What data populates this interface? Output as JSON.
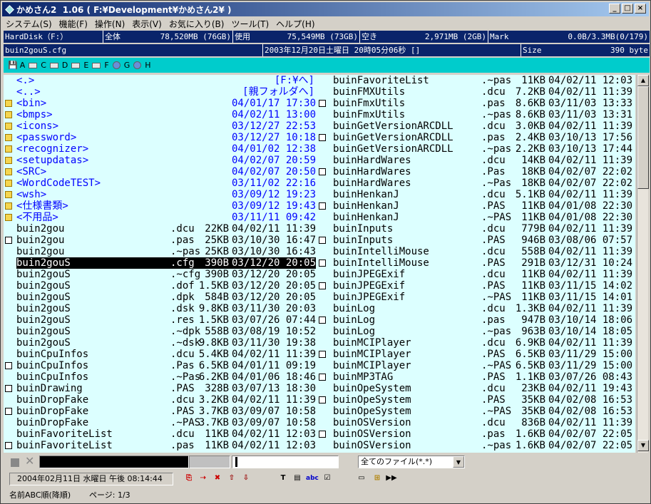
{
  "title": "かめさん2  1.06 ( F:¥Development¥かめさん2¥ )",
  "menu": [
    "システム(S)",
    "機能(F)",
    "操作(N)",
    "表示(V)",
    "お気に入り(B)",
    "ツール(T)",
    "ヘルプ(H)"
  ],
  "info1": {
    "drive": "HardDisk（F:）",
    "total_label": "全体",
    "total_value": "78,520MB (76GB)",
    "used_label": "使用",
    "used_value": "75,549MB (73GB)",
    "free_label": "空き",
    "free_value": "2,971MB (2GB)",
    "mark_label": "Mark",
    "mark_value": "0.0B/3.3MB(0/179)"
  },
  "info2": {
    "file": "buin2gouS.cfg",
    "date": "2003年12月20日土曜日 20時05分06秒 []",
    "size_label": "Size",
    "size_value": "390 byte"
  },
  "drives": [
    "A",
    "C",
    "D",
    "E",
    "F",
    "G",
    "H"
  ],
  "left_rows": [
    {
      "type": "up",
      "nm": "<.>",
      "ex": "",
      "sz": "",
      "dt": "[F:¥へ]"
    },
    {
      "type": "up",
      "nm": "<..>",
      "ex": "",
      "sz": "",
      "dt": "[親フォルダへ]"
    },
    {
      "type": "dir",
      "nm": "<bin>",
      "ex": "",
      "sz": "",
      "dt": "04/01/17 17:30"
    },
    {
      "type": "dir",
      "nm": "<bmps>",
      "ex": "",
      "sz": "",
      "dt": "04/02/11 13:00"
    },
    {
      "type": "dir",
      "nm": "<icons>",
      "ex": "",
      "sz": "",
      "dt": "03/12/27 22:53"
    },
    {
      "type": "dir",
      "nm": "<password>",
      "ex": "",
      "sz": "",
      "dt": "03/12/27 10:18"
    },
    {
      "type": "dir",
      "nm": "<recognizer>",
      "ex": "",
      "sz": "",
      "dt": "04/01/02 12:38"
    },
    {
      "type": "dir",
      "nm": "<setupdatas>",
      "ex": "",
      "sz": "",
      "dt": "04/02/07 20:59"
    },
    {
      "type": "dir",
      "nm": "<SRC>",
      "ex": "",
      "sz": "",
      "dt": "04/02/07 20:50"
    },
    {
      "type": "dir",
      "nm": "<WordCodeTEST>",
      "ex": "",
      "sz": "",
      "dt": "03/11/02 22:16"
    },
    {
      "type": "dir",
      "nm": "<wsh>",
      "ex": "",
      "sz": "",
      "dt": "03/09/12 19:23"
    },
    {
      "type": "dir",
      "nm": "<仕様書類>",
      "ex": "",
      "sz": "",
      "dt": "03/09/12 19:43"
    },
    {
      "type": "dir",
      "nm": "<不用品>",
      "ex": "",
      "sz": "",
      "dt": "03/11/11 09:42"
    },
    {
      "type": "file",
      "nm": "buin2gou",
      "ex": ".dcu",
      "sz": "22KB",
      "dt": "04/02/11 11:39"
    },
    {
      "type": "doc",
      "nm": "buin2gou",
      "ex": ".pas",
      "sz": "25KB",
      "dt": "03/10/30 16:47"
    },
    {
      "type": "file",
      "nm": "buin2gou",
      "ex": ".~pas",
      "sz": "25KB",
      "dt": "03/10/30 16:43"
    },
    {
      "type": "sel",
      "nm": "buin2gouS",
      "ex": ".cfg",
      "sz": "390B",
      "dt": "03/12/20 20:05"
    },
    {
      "type": "file",
      "nm": "buin2gouS",
      "ex": ".~cfg",
      "sz": "390B",
      "dt": "03/12/20 20:05"
    },
    {
      "type": "file",
      "nm": "buin2gouS",
      "ex": ".dof",
      "sz": "1.5KB",
      "dt": "03/12/20 20:05"
    },
    {
      "type": "file",
      "nm": "buin2gouS",
      "ex": ".dpk",
      "sz": "584B",
      "dt": "03/12/20 20:05"
    },
    {
      "type": "file",
      "nm": "buin2gouS",
      "ex": ".dsk",
      "sz": "9.8KB",
      "dt": "03/11/30 20:03"
    },
    {
      "type": "file",
      "nm": "buin2gouS",
      "ex": ".res",
      "sz": "1.5KB",
      "dt": "03/07/26 07:44"
    },
    {
      "type": "file",
      "nm": "buin2gouS",
      "ex": ".~dpk",
      "sz": "558B",
      "dt": "03/08/19 10:52"
    },
    {
      "type": "file",
      "nm": "buin2gouS",
      "ex": ".~dsk",
      "sz": "9.8KB",
      "dt": "03/11/30 19:38"
    },
    {
      "type": "file",
      "nm": "buinCpuInfos",
      "ex": ".dcu",
      "sz": "5.4KB",
      "dt": "04/02/11 11:39"
    },
    {
      "type": "doc",
      "nm": "buinCpuInfos",
      "ex": ".Pas",
      "sz": "6.5KB",
      "dt": "04/01/11 09:19"
    },
    {
      "type": "file",
      "nm": "buinCpuInfos",
      "ex": ".~Pas",
      "sz": "6.2KB",
      "dt": "04/01/06 18:46"
    },
    {
      "type": "doc",
      "nm": "buinDrawing",
      "ex": ".PAS",
      "sz": "328B",
      "dt": "03/07/13 18:30"
    },
    {
      "type": "file",
      "nm": "buinDropFake",
      "ex": ".dcu",
      "sz": "3.2KB",
      "dt": "04/02/11 11:39"
    },
    {
      "type": "doc",
      "nm": "buinDropFake",
      "ex": ".PAS",
      "sz": "3.7KB",
      "dt": "03/09/07 10:58"
    },
    {
      "type": "file",
      "nm": "buinDropFake",
      "ex": ".~PAS",
      "sz": "3.7KB",
      "dt": "03/09/07 10:58"
    },
    {
      "type": "file",
      "nm": "buinFavoriteList",
      "ex": ".dcu",
      "sz": "11KB",
      "dt": "04/02/11 12:03"
    },
    {
      "type": "doc",
      "nm": "buinFavoriteList",
      "ex": ".pas",
      "sz": "11KB",
      "dt": "04/02/11 12:03"
    }
  ],
  "right_rows": [
    {
      "type": "file",
      "nm": "buinFavoriteList",
      "ex": ".~pas",
      "sz": "11KB",
      "dt": "04/02/11 12:03"
    },
    {
      "type": "file",
      "nm": "buinFMXUtils",
      "ex": ".dcu",
      "sz": "7.2KB",
      "dt": "04/02/11 11:39"
    },
    {
      "type": "doc",
      "nm": "buinFmxUtils",
      "ex": ".pas",
      "sz": "8.6KB",
      "dt": "03/11/03 13:33"
    },
    {
      "type": "file",
      "nm": "buinFmxUtils",
      "ex": ".~pas",
      "sz": "8.6KB",
      "dt": "03/11/03 13:31"
    },
    {
      "type": "file",
      "nm": "buinGetVersionARCDLL",
      "ex": ".dcu",
      "sz": "3.0KB",
      "dt": "04/02/11 11:39"
    },
    {
      "type": "doc",
      "nm": "buinGetVersionARCDLL",
      "ex": ".pas",
      "sz": "2.4KB",
      "dt": "03/10/13 17:56"
    },
    {
      "type": "file",
      "nm": "buinGetVersionARCDLL",
      "ex": ".~pas",
      "sz": "2.2KB",
      "dt": "03/10/13 17:44"
    },
    {
      "type": "file",
      "nm": "buinHardWares",
      "ex": ".dcu",
      "sz": "14KB",
      "dt": "04/02/11 11:39"
    },
    {
      "type": "doc",
      "nm": "buinHardWares",
      "ex": ".Pas",
      "sz": "18KB",
      "dt": "04/02/07 22:02"
    },
    {
      "type": "file",
      "nm": "buinHardWares",
      "ex": ".~Pas",
      "sz": "18KB",
      "dt": "04/02/07 22:02"
    },
    {
      "type": "file",
      "nm": "buinHenkanJ",
      "ex": ".dcu",
      "sz": "5.1KB",
      "dt": "04/02/11 11:39"
    },
    {
      "type": "doc",
      "nm": "buinHenkanJ",
      "ex": ".PAS",
      "sz": "11KB",
      "dt": "04/01/08 22:30"
    },
    {
      "type": "file",
      "nm": "buinHenkanJ",
      "ex": ".~PAS",
      "sz": "11KB",
      "dt": "04/01/08 22:30"
    },
    {
      "type": "file",
      "nm": "buinInputs",
      "ex": ".dcu",
      "sz": "779B",
      "dt": "04/02/11 11:39"
    },
    {
      "type": "doc",
      "nm": "buinInputs",
      "ex": ".PAS",
      "sz": "946B",
      "dt": "03/08/06 07:57"
    },
    {
      "type": "file",
      "nm": "buinIntelliMouse",
      "ex": ".dcu",
      "sz": "558B",
      "dt": "04/02/11 11:39"
    },
    {
      "type": "doc",
      "nm": "buinIntelliMouse",
      "ex": ".PAS",
      "sz": "291B",
      "dt": "03/12/31 10:24"
    },
    {
      "type": "file",
      "nm": "buinJPEGExif",
      "ex": ".dcu",
      "sz": "11KB",
      "dt": "04/02/11 11:39"
    },
    {
      "type": "doc",
      "nm": "buinJPEGExif",
      "ex": ".PAS",
      "sz": "11KB",
      "dt": "03/11/15 14:02"
    },
    {
      "type": "file",
      "nm": "buinJPEGExif",
      "ex": ".~PAS",
      "sz": "11KB",
      "dt": "03/11/15 14:01"
    },
    {
      "type": "file",
      "nm": "buinLog",
      "ex": ".dcu",
      "sz": "1.3KB",
      "dt": "04/02/11 11:39"
    },
    {
      "type": "doc",
      "nm": "buinLog",
      "ex": ".pas",
      "sz": "947B",
      "dt": "03/10/14 18:06"
    },
    {
      "type": "file",
      "nm": "buinLog",
      "ex": ".~pas",
      "sz": "963B",
      "dt": "03/10/14 18:05"
    },
    {
      "type": "file",
      "nm": "buinMCIPlayer",
      "ex": ".dcu",
      "sz": "6.9KB",
      "dt": "04/02/11 11:39"
    },
    {
      "type": "doc",
      "nm": "buinMCIPlayer",
      "ex": ".PAS",
      "sz": "6.5KB",
      "dt": "03/11/29 15:00"
    },
    {
      "type": "file",
      "nm": "buinMCIPlayer",
      "ex": ".~PAS",
      "sz": "6.5KB",
      "dt": "03/11/29 15:00"
    },
    {
      "type": "doc",
      "nm": "buinMP3TAG",
      "ex": ".PAS",
      "sz": "1.1KB",
      "dt": "03/07/26 08:43"
    },
    {
      "type": "file",
      "nm": "buinOpeSystem",
      "ex": ".dcu",
      "sz": "23KB",
      "dt": "04/02/11 19:43"
    },
    {
      "type": "doc",
      "nm": "buinOpeSystem",
      "ex": ".PAS",
      "sz": "35KB",
      "dt": "04/02/08 16:53"
    },
    {
      "type": "file",
      "nm": "buinOpeSystem",
      "ex": ".~PAS",
      "sz": "35KB",
      "dt": "04/02/08 16:53"
    },
    {
      "type": "file",
      "nm": "buinOSVersion",
      "ex": ".dcu",
      "sz": "836B",
      "dt": "04/02/11 11:39"
    },
    {
      "type": "doc",
      "nm": "buinOSVersion",
      "ex": ".pas",
      "sz": "1.6KB",
      "dt": "04/02/07 22:05"
    },
    {
      "type": "file",
      "nm": "buinOSVersion",
      "ex": ".~pas",
      "sz": "1.6KB",
      "dt": "04/02/07 22:05"
    }
  ],
  "filter": "全てのファイル(*.*)",
  "status_date": "2004年02月11日 水曜日 午後 08:14:44",
  "sort_label": "名前ABC順(降順)",
  "page_label": "ページ: 1/3"
}
